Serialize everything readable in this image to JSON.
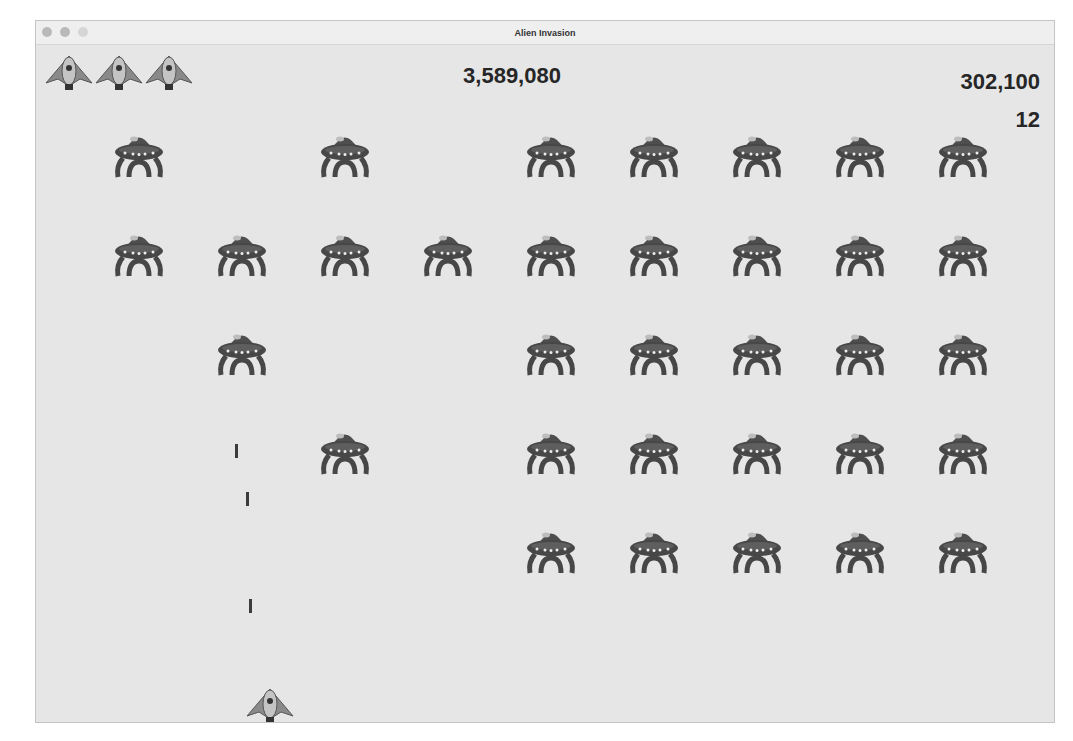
{
  "window": {
    "title": "Alien Invasion"
  },
  "hud": {
    "lives": 3,
    "score": "3,589,080",
    "high_score": "302,100",
    "level": "12"
  },
  "fleet": [
    {
      "aliens": [
        true,
        false,
        true,
        false,
        true,
        true,
        true,
        true,
        true
      ]
    },
    {
      "aliens": [
        true,
        true,
        true,
        true,
        true,
        true,
        true,
        true,
        true
      ]
    },
    {
      "aliens": [
        false,
        true,
        false,
        false,
        true,
        true,
        true,
        true,
        true
      ]
    },
    {
      "aliens": [
        false,
        false,
        true,
        false,
        true,
        true,
        true,
        true,
        true
      ]
    },
    {
      "aliens": [
        false,
        false,
        false,
        false,
        true,
        true,
        true,
        true,
        true
      ]
    }
  ],
  "bullets": 3
}
